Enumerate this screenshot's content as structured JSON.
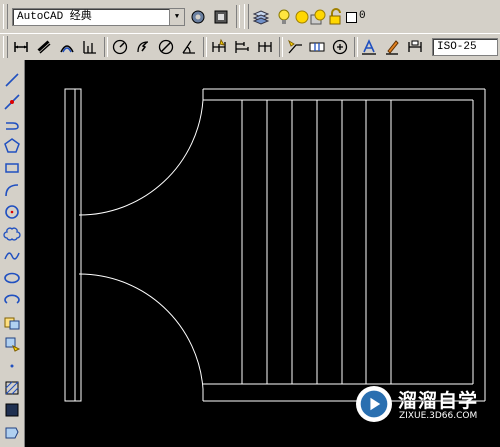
{
  "toolbar_top": {
    "workspace_value": "AutoCAD 经典",
    "layer_value": "0"
  },
  "toolbar_dim": {
    "dimstyle_value": "ISO-25"
  },
  "watermark": {
    "brand": "溜溜自学",
    "url": "ZIXUE.3D66.COM"
  },
  "colors": {
    "canvas": "#000000",
    "toolbar": "#d4d0c8",
    "drawing_lines": "#ffffff",
    "accent_yellow": "#ffd700"
  }
}
